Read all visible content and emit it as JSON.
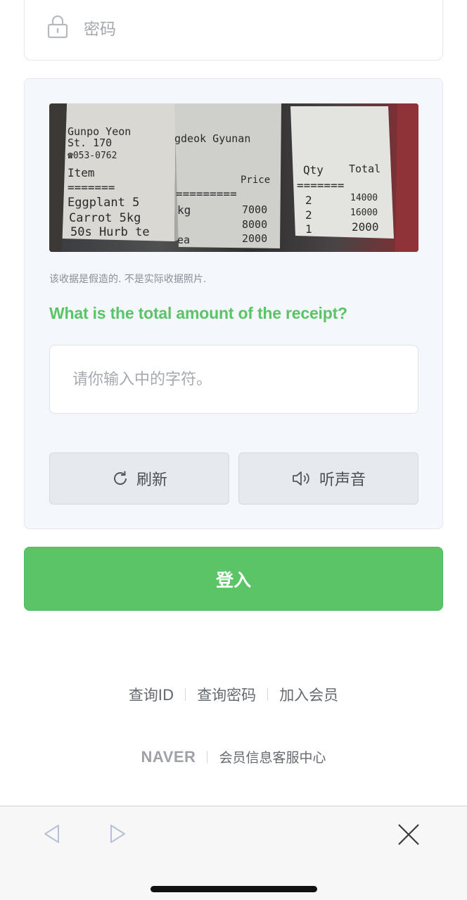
{
  "password_field": {
    "placeholder": "密码",
    "icon": "lock-icon"
  },
  "captcha": {
    "image": {
      "receipt_left": [
        "Gunpo Yeon",
        "St. 170",
        "☎053-0762",
        "Item",
        "Eggplant 5",
        "Carrot 5kg",
        "50s Hurb te"
      ],
      "receipt_middle": [
        "gdeok Gyunan",
        "Price",
        "kg",
        "7000",
        "8000",
        "ea",
        "2000"
      ],
      "receipt_right_headers": [
        "Qty",
        "Total"
      ],
      "receipt_right_rows": [
        [
          "2",
          "14000"
        ],
        [
          "2",
          "16000"
        ],
        [
          "1",
          "2000"
        ]
      ]
    },
    "disclaimer": "该收据是假造的. 不是实际收据照片.",
    "question": "What is the total amount of the receipt?",
    "input_placeholder": "请你输入中的字符。",
    "refresh_label": "刷新",
    "refresh_icon": "refresh-icon",
    "audio_label": "听声音",
    "audio_icon": "speaker-icon"
  },
  "login_button": "登入",
  "links": {
    "find_id": "查询ID",
    "find_password": "查询密码",
    "signup": "加入会员"
  },
  "footer": {
    "logo": "NAVER",
    "customer_center": "会员信息客服中心"
  },
  "browser_bar": {
    "back_icon": "back-arrow-icon",
    "forward_icon": "forward-arrow-icon",
    "close_icon": "close-icon"
  },
  "colors": {
    "accent_green": "#5ac466",
    "panel_bg": "#f4f7fc"
  }
}
